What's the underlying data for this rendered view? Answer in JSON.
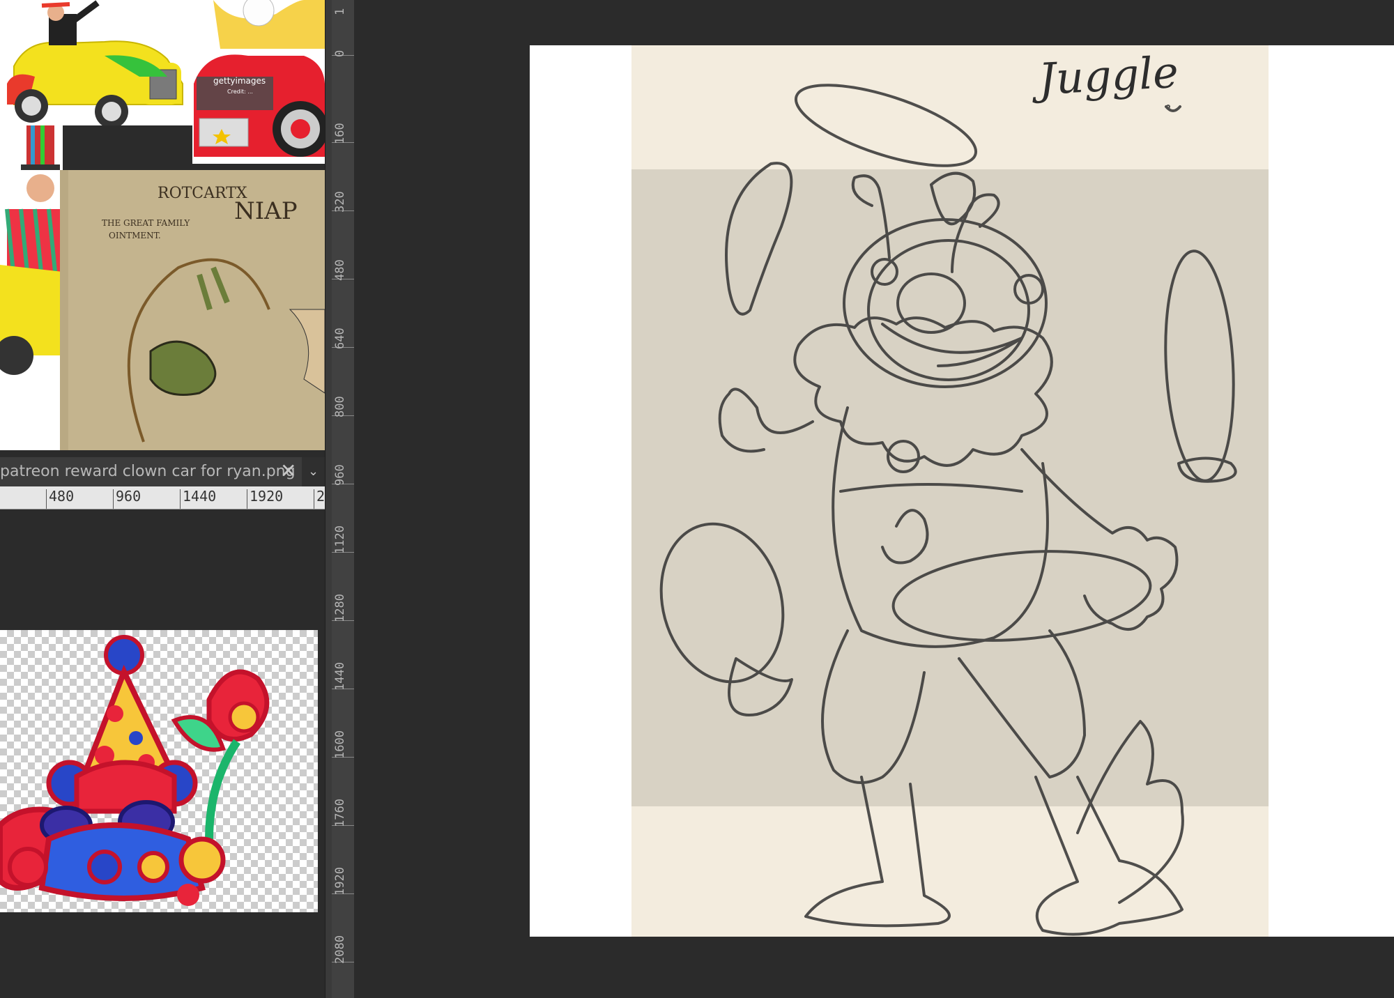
{
  "reference_panel": {
    "getty_text": "gettyimages",
    "getty_credit": "Credit: ...",
    "antique_label_lines": [
      "ROTCARTX",
      "NIAP",
      "THE GREAT FAMILY",
      "OINTMENT."
    ],
    "tab_title": "patreon reward clown car for ryan.png",
    "tab_close_glyph": "✕",
    "tab_dropdown_glyph": "⌄",
    "horizontal_ruler": [
      "480",
      "960",
      "1440",
      "1920",
      "2"
    ]
  },
  "vertical_ruler": [
    "1",
    "0",
    "160",
    "320",
    "480",
    "640",
    "800",
    "960",
    "1120",
    "1280",
    "1440",
    "1600",
    "1760",
    "1920",
    "2080"
  ],
  "canvas": {
    "sketch_note": "Juggle",
    "smiley": "◡"
  },
  "colors": {
    "workspace": "#2b2b2b",
    "paper": "#ffffff",
    "band_light": "#f3ecde",
    "band_mid": "#d8d2c4",
    "sketch_line": "#333333"
  },
  "icons": [
    "close-icon",
    "chevron-down-icon"
  ]
}
